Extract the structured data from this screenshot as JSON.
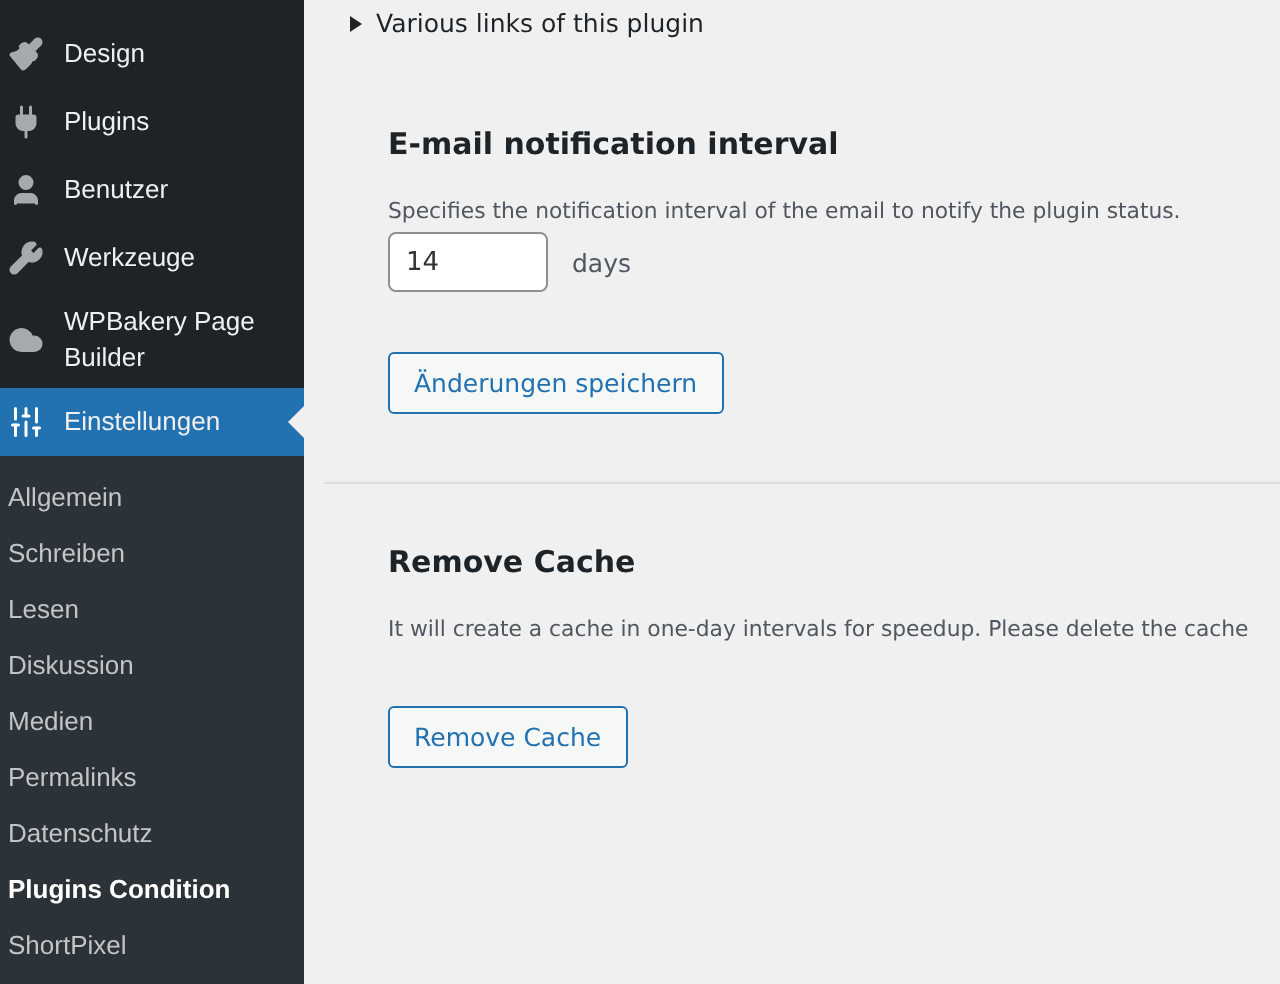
{
  "sidebar": {
    "menu": [
      {
        "label": "Design",
        "selected": false
      },
      {
        "label": "Plugins",
        "selected": false
      },
      {
        "label": "Benutzer",
        "selected": false
      },
      {
        "label": "Werkzeuge",
        "selected": false
      },
      {
        "label": "WPBakery Page Builder",
        "selected": false
      },
      {
        "label": "Einstellungen",
        "selected": true
      }
    ],
    "submenu": [
      {
        "label": "Allgemein",
        "selected": false
      },
      {
        "label": "Schreiben",
        "selected": false
      },
      {
        "label": "Lesen",
        "selected": false
      },
      {
        "label": "Diskussion",
        "selected": false
      },
      {
        "label": "Medien",
        "selected": false
      },
      {
        "label": "Permalinks",
        "selected": false
      },
      {
        "label": "Datenschutz",
        "selected": false
      },
      {
        "label": "Plugins Condition",
        "selected": true
      },
      {
        "label": "ShortPixel",
        "selected": false
      }
    ]
  },
  "links_toggle": {
    "label": "Various links of this plugin",
    "expanded": false
  },
  "sections": [
    {
      "title": "E-mail notification interval",
      "description": "Specifies the notification interval of the email to notify the plugin status.",
      "field": {
        "value": "14",
        "unit": "days"
      },
      "button": "Änderungen speichern"
    },
    {
      "title": "Remove Cache",
      "description": "It will create a cache in one-day intervals for speedup. Please delete the cache",
      "button": "Remove Cache"
    }
  ]
}
